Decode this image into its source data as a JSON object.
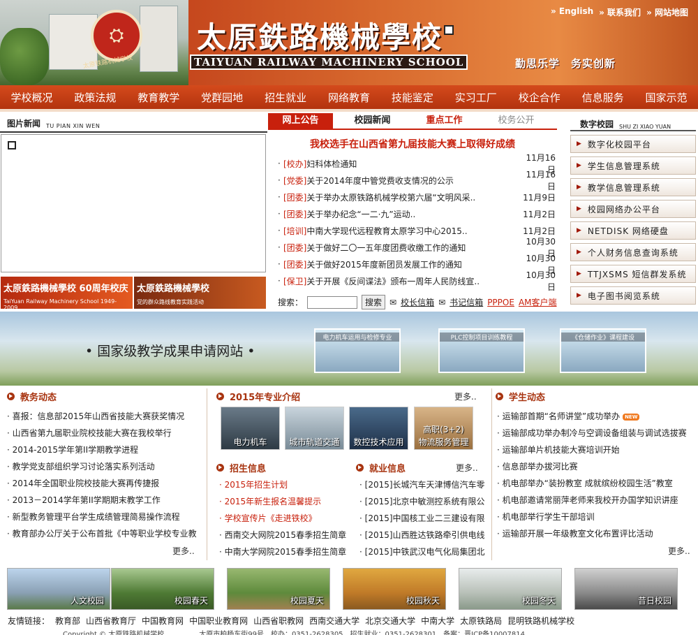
{
  "header": {
    "school_cn": "太原鉄路機械學校",
    "school_en": "TAIYUAN RAILWAY MACHINERY SCHOOL",
    "emblem_text": "太原铁路机械学校",
    "motto": "勤思乐学　务实创新",
    "links": [
      "» English",
      "» 联系我们",
      "» 网站地图"
    ]
  },
  "nav": [
    "学校概况",
    "政策法规",
    "教育教学",
    "党群园地",
    "招生就业",
    "网络教育",
    "技能鉴定",
    "实习工厂",
    "校企合作",
    "信息服务",
    "国家示范"
  ],
  "photo_news": {
    "title": "图片新闻",
    "title_en": "TU PIAN XIN WEN",
    "banner1_title": "太原鉄路機械學校 60周年校庆",
    "banner1_sub": "TaiYuan Railway Machinery School 1949-2009",
    "banner2_title": "太原鉄路機械學校",
    "banner2_sub": "党的群众路线教育实践活动"
  },
  "news": {
    "tabs": [
      "网上公告",
      "校园新闻",
      "重点工作",
      "校务公开"
    ],
    "headline": "我校选手在山西省第九届技能大赛上取得好成绩",
    "items": [
      {
        "tag": "[校办]",
        "title": "妇科体检通知",
        "date": "11月16日"
      },
      {
        "tag": "[党委]",
        "title": "关于2014年度中管党费收支情况的公示",
        "date": "11月16日"
      },
      {
        "tag": "[团委]",
        "title": "关于举办太原铁路机械学校第六届“文明风采..",
        "date": "11月9日"
      },
      {
        "tag": "[团委]",
        "title": "关于举办纪念“一二·九”运动..",
        "date": "11月2日"
      },
      {
        "tag": "[培训]",
        "title": "中南大学现代远程教育太原学习中心2015..",
        "date": "11月2日"
      },
      {
        "tag": "[团委]",
        "title": "关于做好二〇一五年度团费收缴工作的通知",
        "date": "10月30日"
      },
      {
        "tag": "[团委]",
        "title": "关于做好2015年度新团员发展工作的通知",
        "date": "10月30日"
      },
      {
        "tag": "[保卫]",
        "title": "关于开展《反间谍法》颁布一周年人民防线宣..",
        "date": "10月30日"
      }
    ],
    "search_label": "搜索：",
    "search_button": "搜索",
    "link1": "校长信箱",
    "link2": "书记信箱",
    "link3": "PPPOE",
    "link4": "AM客户端"
  },
  "digital": {
    "title": "数字校园",
    "title_en": "SHU ZI XIAO YUAN",
    "items": [
      "数字化校园平台",
      "学生信息管理系统",
      "教学信息管理系统",
      "校园网络办公平台",
      "NETDISK 网络硬盘",
      "个人财务信息查询系统",
      "TTJXSMS 短信群发系统",
      "电子图书阅览系统"
    ]
  },
  "banner": {
    "title": "• 国家级教学成果申请网站 •",
    "thumbs": [
      "电力机车运用与检修专业",
      "PLC控制项目训练教程",
      "《仓储作业》课程建设"
    ]
  },
  "academic": {
    "title": "教务动态",
    "items": [
      "喜报：信息部2015年山西省技能大赛获奖情况",
      "山西省第九届职业院校技能大赛在我校举行",
      "2014-2015学年第II学期教学进程",
      "教学党支部组织学习讨论落实系列活动",
      "2014年全国职业院校技能大赛再传捷报",
      "2013－2014学年第II学期期末教学工作",
      "新型教务管理平台学生成绩管理简易操作流程",
      "教育部办公厅关于公布首批《中等职业学校专业教"
    ],
    "more": "更多.."
  },
  "majors": {
    "title": "2015年专业介绍",
    "more": "更多..",
    "items": [
      "电力机车",
      "城市轨道交通",
      "数控技术应用",
      "物流服务管理"
    ],
    "badge": "高职(3+2)"
  },
  "admission": {
    "title": "招生信息",
    "items": [
      "2015年招生计划",
      "2015年新生报名温馨提示",
      "学校宣传片《走进铁校》",
      "西南交大网院2015春季招生简章",
      "中南大学网院2015春季招生简章"
    ]
  },
  "employment": {
    "title": "就业信息",
    "more": "更多..",
    "items": [
      "[2015]长城汽车天津博信汽车零",
      "[2015]北京中敏测控系统有限公",
      "[2015]中国核工业二三建设有限",
      "[2015]山西胜达铁路牵引供电线",
      "[2015]中铁武汉电气化局集团北"
    ]
  },
  "student": {
    "title": "学生动态",
    "new_badge": "NEW",
    "items": [
      "运输部首期“名师讲堂”成功举办",
      "运输部成功举办制冷与空调设备组装与调试选拔赛",
      "运输部单片机技能大赛培训开始",
      "信息部举办拔河比赛",
      "机电部举办“装扮教室 成就缤纷校园生活”教室",
      "机电部邀请常丽萍老师来我校开办国学知识讲座",
      "机电部举行学生干部培训",
      "运输部开展一年级教室文化布置评比活动"
    ],
    "more": "更多.."
  },
  "campus_photos": [
    "人文校园",
    "校园春天",
    "校园夏天",
    "校园秋天",
    "校园冬天",
    "昔日校园"
  ],
  "friends": {
    "label": "友情链接：",
    "items": [
      "教育部",
      "山西省教育厅",
      "中国教育网",
      "中国职业教育网",
      "山西省职教网",
      "西南交通大学",
      "北京交通大学",
      "中南大学",
      "太原铁路局",
      "昆明铁路机械学校"
    ]
  },
  "footer": "Copyright © 太原铁路机械学校　　　　　太原市柏杨东街99号　校办：0351-2628305　招生就业：0351-2628301　备案：晋ICP备10007814"
}
